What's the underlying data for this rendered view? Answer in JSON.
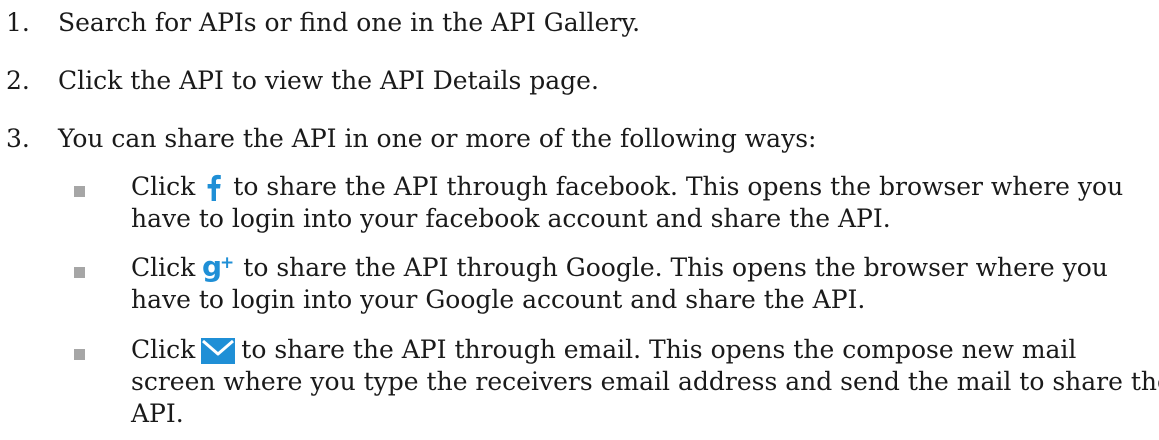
{
  "steps": [
    {
      "number": "1.",
      "text": "Search for APIs or find one in the API Gallery."
    },
    {
      "number": "2.",
      "text": "Click the API to view the API Details page."
    },
    {
      "number": "3.",
      "text": "You can share the API in one or more of the following ways:"
    }
  ],
  "bullets": [
    {
      "prefix": "Click",
      "icon": "facebook-icon",
      "line1_rest": "to share the API through facebook. This opens the browser where you",
      "line2": "have to login into your facebook account and share the API."
    },
    {
      "prefix": "Click",
      "icon": "google-plus-icon",
      "line1_rest": "to share the API through Google. This opens the browser where you",
      "line2": "have to login into your Google account and share the API."
    },
    {
      "prefix": "Click",
      "icon": "email-icon",
      "line1_rest": "to share the API through email. This opens the compose new mail",
      "line2": "screen where you type the receivers email address and send the mail to share the",
      "line3": "API."
    }
  ],
  "colors": {
    "text": "#1a1a1a",
    "bullet_square": "#a6a6a6",
    "icon_blue": "#1f8fd6"
  }
}
